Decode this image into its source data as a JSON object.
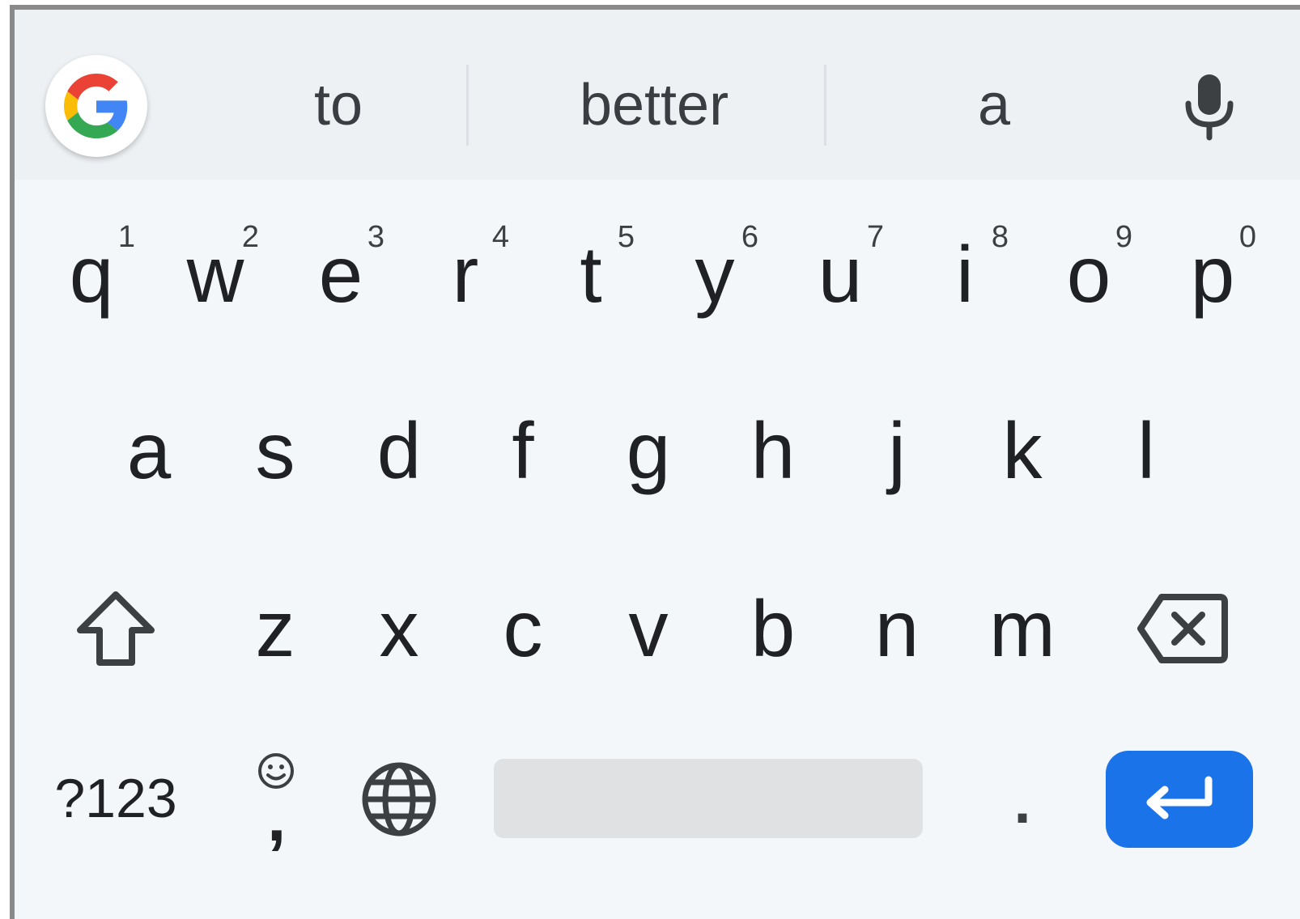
{
  "suggestions": {
    "left": "to",
    "center": "better",
    "right": "a"
  },
  "rows": {
    "row1": [
      {
        "letter": "q",
        "hint": "1"
      },
      {
        "letter": "w",
        "hint": "2"
      },
      {
        "letter": "e",
        "hint": "3"
      },
      {
        "letter": "r",
        "hint": "4"
      },
      {
        "letter": "t",
        "hint": "5"
      },
      {
        "letter": "y",
        "hint": "6"
      },
      {
        "letter": "u",
        "hint": "7"
      },
      {
        "letter": "i",
        "hint": "8"
      },
      {
        "letter": "o",
        "hint": "9"
      },
      {
        "letter": "p",
        "hint": "0"
      }
    ],
    "row2": [
      "a",
      "s",
      "d",
      "f",
      "g",
      "h",
      "j",
      "k",
      "l"
    ],
    "row3": [
      "z",
      "x",
      "c",
      "v",
      "b",
      "n",
      "m"
    ]
  },
  "bottom_row": {
    "symbols_label": "?123",
    "comma_label": ",",
    "period_label": "."
  },
  "icons": {
    "google": "google-g-icon",
    "mic": "microphone-icon",
    "shift": "shift-arrow-icon",
    "backspace": "backspace-icon",
    "emoji": "smiley-icon",
    "globe": "globe-icon",
    "enter": "enter-return-icon"
  },
  "colors": {
    "keyboard_background": "#f4f7fa",
    "suggestion_strip": "#eef1f4",
    "enter_key": "#1a73e8",
    "space_bar": "#dfe1e3"
  }
}
